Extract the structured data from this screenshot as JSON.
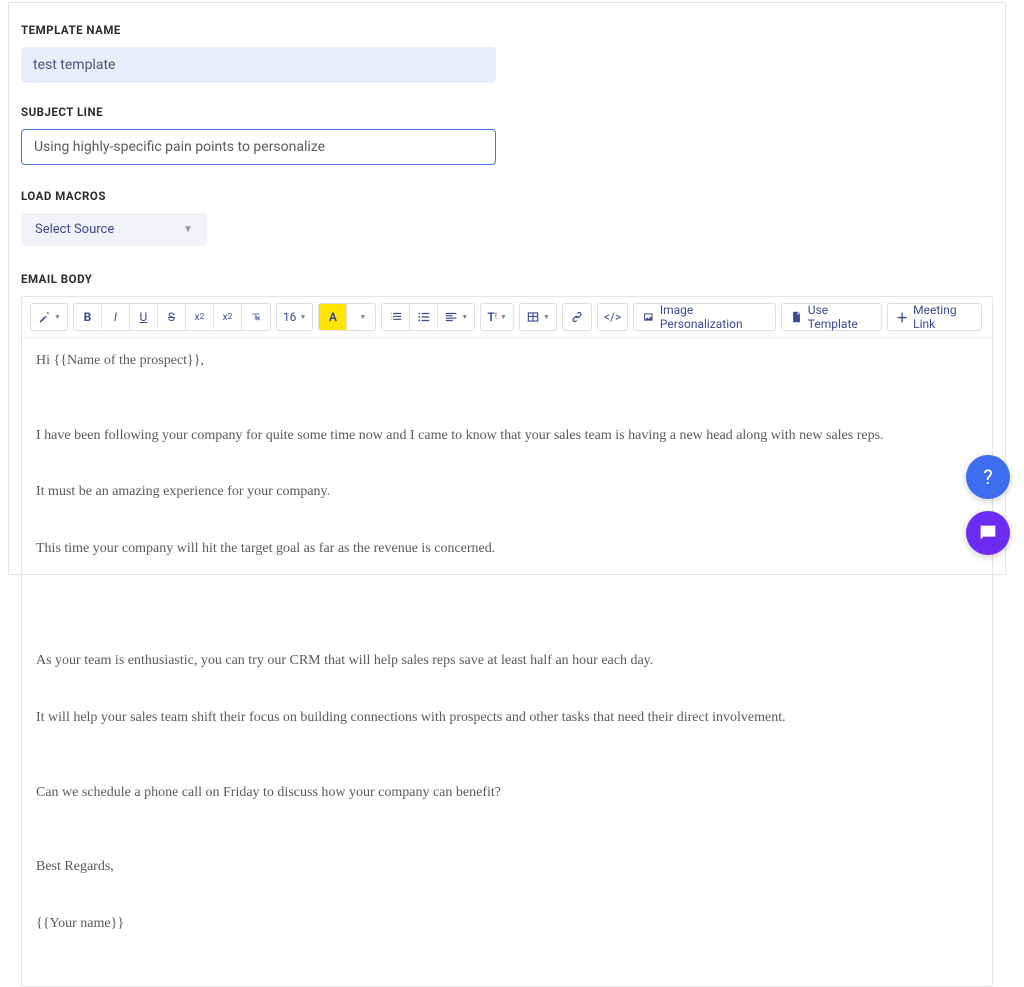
{
  "labels": {
    "templateName": "TEMPLATE NAME",
    "subjectLine": "SUBJECT LINE",
    "loadMacros": "LOAD MACROS",
    "emailBody": "EMAIL BODY"
  },
  "templateName": "test template",
  "subjectLine": "Using highly-specific pain points to personalize",
  "macroSelect": "Select Source",
  "toolbar": {
    "magic": "magic-wand-icon",
    "bold": "B",
    "italic": "I",
    "underline": "U",
    "strike": "S",
    "super": "x²",
    "sub": "x₂",
    "clear": "clear-format-icon",
    "fontSize": "16",
    "color": "A",
    "ol": "ordered-list-icon",
    "ul": "unordered-list-icon",
    "align": "align-icon",
    "textformat": "T!",
    "table": "table-icon",
    "link": "link-icon",
    "code": "</>",
    "imagePersonalization": "Image Personalization",
    "useTemplate": "Use Template",
    "meetingLink": "Meeting Link"
  },
  "body": {
    "greeting": "Hi {{Name of the prospect}},",
    "p1l1": "I have been following your company for quite some time now and I came to know that your sales team is having a new head along with new sales reps.",
    "p1l2": "It must be an amazing experience for your company.",
    "p1l3": "This time your company will hit the target goal as far as the revenue is concerned.",
    "p2l1": "As your team is enthusiastic, you can try our CRM that will help sales reps save at least half an hour each day.",
    "p2l2": "It will help your sales team shift their focus on building connections with prospects and other tasks that need their direct involvement.",
    "p3": "Can we schedule a phone call on Friday to discuss how your company can benefit?",
    "signoff": "Best Regards,",
    "signature": "{{Your name}}"
  },
  "fabs": {
    "help": "?",
    "chat": "chat-icon"
  }
}
